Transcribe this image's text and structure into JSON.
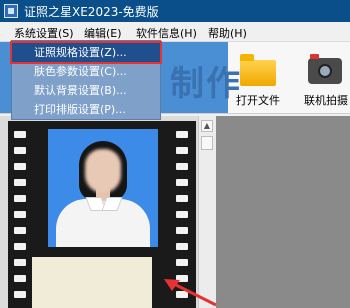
{
  "window": {
    "title": "证照之星XE2023-免费版",
    "icon": "app-icon"
  },
  "menubar": {
    "items": [
      {
        "label": "系统设置(S)"
      },
      {
        "label": "编辑(E)"
      },
      {
        "label": "软件信息(H)"
      },
      {
        "label": "帮助(H)"
      }
    ]
  },
  "system_menu": {
    "items": [
      {
        "label": "证照规格设置(Z)...",
        "highlighted": true
      },
      {
        "label": "肤色参数设置(C)..."
      },
      {
        "label": "默认背景设置(B)..."
      },
      {
        "label": "打印排版设置(P)..."
      }
    ]
  },
  "toolbar": {
    "banner_text": "制作",
    "buttons": [
      {
        "label": "打开文件",
        "icon": "folder-icon"
      },
      {
        "label": "联机拍摄",
        "icon": "camera-icon"
      }
    ]
  },
  "colors": {
    "title_bar": "#0a4f8a",
    "menu_background": "#7fa1c9",
    "highlight_item": "#1f4f8c",
    "annotation_red": "#e63232",
    "photo_background": "#3c8be8",
    "film_strip": "#1a1a1a",
    "workspace_dark": "#8a8a8a"
  }
}
